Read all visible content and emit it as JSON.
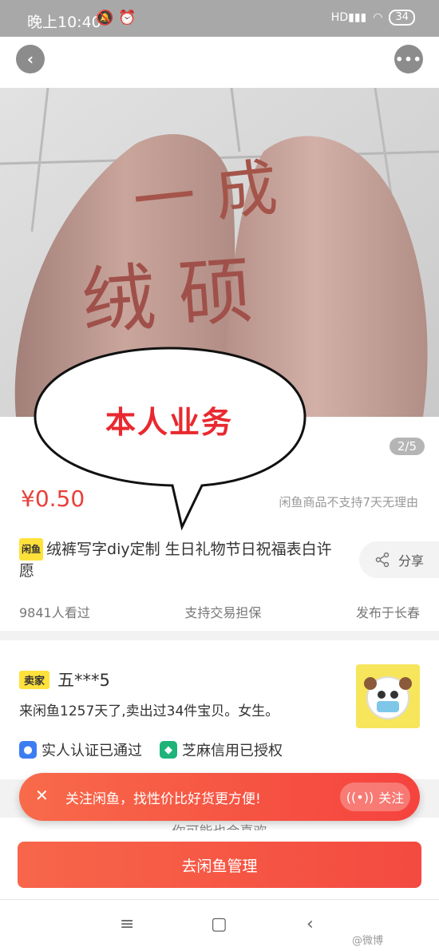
{
  "status_bar": {
    "time": "晚上10:40",
    "icons": [
      "bell-off-icon",
      "alarm-icon",
      "signal-icon",
      "wifi-icon"
    ],
    "network": "HD",
    "battery": "34"
  },
  "nav": {
    "back_icon": "‹",
    "more_icon": "•••"
  },
  "gallery": {
    "page_indicator": "2/5",
    "photo_text_lines": [
      "一 成",
      "绒 硕"
    ]
  },
  "overlay": {
    "bubble_text": "本人业务"
  },
  "product": {
    "price": "¥0.50",
    "policy": "闲鱼商品不支持7天无理由",
    "tag": "闲鱼",
    "title": "绒裤写字diy定制 生日礼物节日祝福表白许愿",
    "share_label": "分享",
    "views": "9841人看过",
    "guarantee": "支持交易担保",
    "location": "发布于长春"
  },
  "seller": {
    "tag": "卖家",
    "name": "五***5",
    "info": "来闲鱼1257天了,卖出过34件宝贝。女生。",
    "verify_real": "实人认证已通过",
    "verify_credit": "芝麻信用已授权"
  },
  "follow_banner": {
    "close_icon": "✕",
    "text": "关注闲鱼，找性价比好货更方便!",
    "button": "关注"
  },
  "recommend": {
    "label": "你可能也会喜欢"
  },
  "cta": {
    "label": "去闲鱼管理"
  },
  "nav_bar": {
    "menu_icon": "≡",
    "home_icon": "▢",
    "back_icon": "‹",
    "watermark": "@微博"
  },
  "colors": {
    "accent": "#f5433e",
    "price": "#e8403a",
    "tag": "#ffe13b",
    "bubble_text": "#e8292f"
  }
}
